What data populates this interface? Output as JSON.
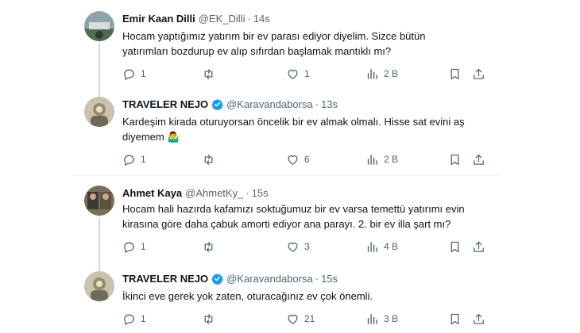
{
  "tweets": [
    {
      "name": "Emir Kaan Dilli",
      "handle": "@EK_Dilli",
      "time": "14s",
      "verified": false,
      "lines": [
        "Hocam yaptığımız yatırım bir ev parası ediyor diyelim. Sizce bütün",
        "yatırımları bozdurup ev alıp sıfırdan başlamak mantıklı mı?"
      ],
      "replies": "1",
      "retweets": "",
      "likes": "1",
      "views": "2 B"
    },
    {
      "name": "TRAVELER NEJO",
      "handle": "@Karavandaborsa",
      "time": "13s",
      "verified": true,
      "lines": [
        "Kardeşim kirada oturuyorsan öncelik bir ev almak olmalı. Hisse sat evini aş",
        "diyemem 🤷‍♂️"
      ],
      "replies": "1",
      "retweets": "",
      "likes": "6",
      "views": "2 B"
    },
    {
      "name": "Ahmet Kaya",
      "handle": "@AhmetKy_",
      "time": "15s",
      "verified": false,
      "lines": [
        "Hocam hali hazırda kafamızı soktuğumuz bir ev varsa temettü yatırımı evin",
        "kirasına göre daha çabuk amorti ediyor ana parayı. 2. bir ev illa şart mı?"
      ],
      "replies": "1",
      "retweets": "",
      "likes": "3",
      "views": "4 B"
    },
    {
      "name": "TRAVELER NEJO",
      "handle": "@Karavandaborsa",
      "time": "15s",
      "verified": true,
      "lines": [
        "İkinci eve gerek yok zaten, oturacağınız ev çok önemli."
      ],
      "replies": "1",
      "retweets": "",
      "likes": "21",
      "views": "3 B"
    }
  ],
  "separator_symbol": "·",
  "colors": {
    "verified": "#1d9bf0",
    "muted": "#536471",
    "text": "#0f1419",
    "line": "#cfd9de"
  }
}
